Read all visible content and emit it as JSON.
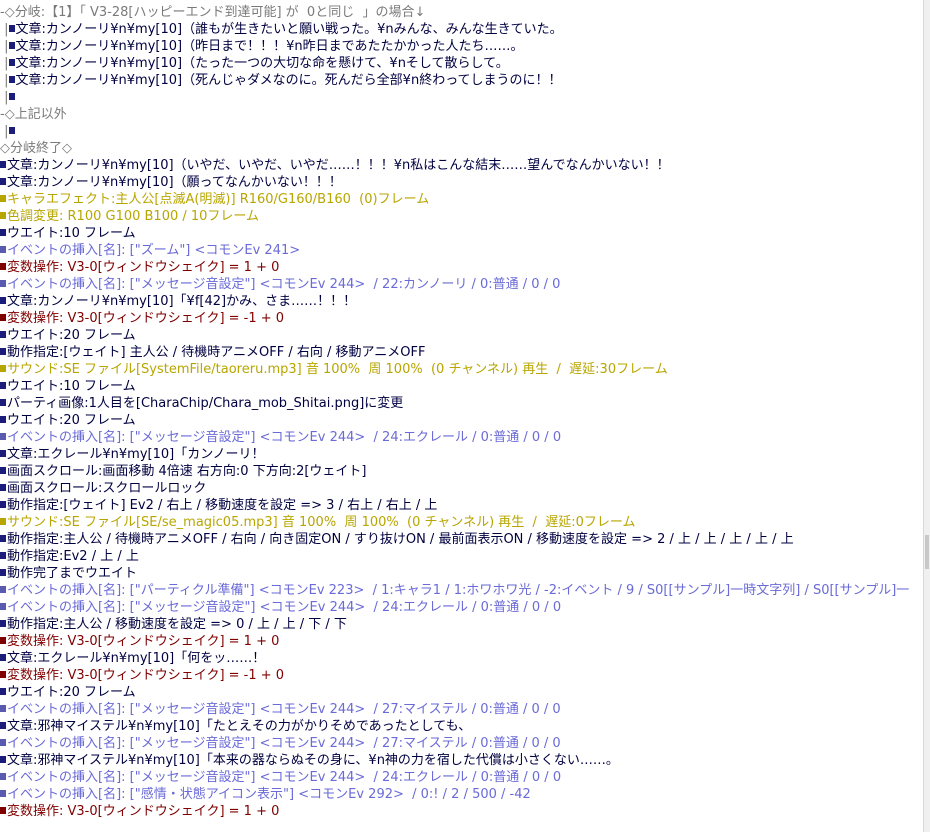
{
  "colors": {
    "message": "#000040",
    "comment": "#7a7a7a",
    "event": "#6a6ad8",
    "variable": "#800000",
    "effect": "#b8a600",
    "square_message": "#1c1c7a",
    "square_event": "#5a5ab0",
    "square_var": "#800000",
    "square_yellow": "#b8a600"
  },
  "lines": [
    {
      "indent": "-",
      "color": "comment",
      "square": null,
      "text": "◇分岐:【1】「 V3-28[ハッピーエンド到達可能] が  0と同じ  」の場合↓"
    },
    {
      "indent": " |",
      "color": "message",
      "square": "message",
      "text": "文章:カンノーリ¥n¥my[10]（誰もが生きたいと願い戦った。¥nみんな、みんな生きていた。"
    },
    {
      "indent": " |",
      "color": "message",
      "square": "message",
      "text": "文章:カンノーリ¥n¥my[10]（昨日まで！！！¥n昨日まであたたかかった人たち……。"
    },
    {
      "indent": " |",
      "color": "message",
      "square": "message",
      "text": "文章:カンノーリ¥n¥my[10]（たった一つの大切な命を懸けて、¥nそして散らして。"
    },
    {
      "indent": " |",
      "color": "message",
      "square": "message",
      "text": "文章:カンノーリ¥n¥my[10]（死んじゃダメなのに。死んだら全部¥n終わってしまうのに！！"
    },
    {
      "indent": " |",
      "color": "message",
      "square": "message",
      "text": ""
    },
    {
      "indent": "-",
      "color": "comment",
      "square": null,
      "text": "◇上記以外"
    },
    {
      "indent": " |",
      "color": "message",
      "square": "message",
      "text": ""
    },
    {
      "indent": "",
      "color": "comment",
      "square": null,
      "text": "◇分岐終了◇"
    },
    {
      "indent": "",
      "color": "message",
      "square": "message",
      "text": "文章:カンノーリ¥n¥my[10]（いやだ、いやだ、いやだ……！！！¥n私はこんな結末……望んでなんかいない！！"
    },
    {
      "indent": "",
      "color": "message",
      "square": "message",
      "text": "文章:カンノーリ¥n¥my[10]（願ってなんかいない！！！"
    },
    {
      "indent": "",
      "color": "effect",
      "square": "yellow",
      "text": "キャラエフェクト:主人公[点滅A(明滅)] R160/G160/B160  (0)フレーム"
    },
    {
      "indent": "",
      "color": "effect",
      "square": "yellow",
      "text": "色調変更: R100 G100 B100 / 10フレーム"
    },
    {
      "indent": "",
      "color": "message",
      "square": "message",
      "text": "ウエイト:10 フレーム"
    },
    {
      "indent": "",
      "color": "event",
      "square": "event",
      "text": "イベントの挿入[名]: [\"ズーム\"] <コモンEv 241>"
    },
    {
      "indent": "",
      "color": "variable",
      "square": "var",
      "text": "変数操作: V3-0[ウィンドウシェイク] = 1 + 0"
    },
    {
      "indent": "",
      "color": "event",
      "square": "event",
      "text": "イベントの挿入[名]: [\"メッセージ音設定\"] <コモンEv 244>  / 22:カンノーリ / 0:普通 / 0 / 0"
    },
    {
      "indent": "",
      "color": "message",
      "square": "message",
      "text": "文章:カンノーリ¥n¥my[10]「¥f[42]かみ、さま……！！！"
    },
    {
      "indent": "",
      "color": "variable",
      "square": "var",
      "text": "変数操作: V3-0[ウィンドウシェイク] = -1 + 0"
    },
    {
      "indent": "",
      "color": "message",
      "square": "message",
      "text": "ウエイト:20 フレーム"
    },
    {
      "indent": "",
      "color": "message",
      "square": "message",
      "text": "動作指定:[ウェイト] 主人公 / 待機時アニメOFF / 右向 / 移動アニメOFF"
    },
    {
      "indent": "",
      "color": "effect",
      "square": "yellow",
      "text": "サウンド:SE ファイル[SystemFile/taoreru.mp3] 音 100%  周 100%  (0 チャンネル) 再生  /  遅延:30フレーム"
    },
    {
      "indent": "",
      "color": "message",
      "square": "message",
      "text": "ウエイト:10 フレーム"
    },
    {
      "indent": "",
      "color": "message",
      "square": "message",
      "text": "パーティ画像:1人目を[CharaChip/Chara_mob_Shitai.png]に変更"
    },
    {
      "indent": "",
      "color": "message",
      "square": "message",
      "text": "ウエイト:20 フレーム"
    },
    {
      "indent": "",
      "color": "event",
      "square": "event",
      "text": "イベントの挿入[名]: [\"メッセージ音設定\"] <コモンEv 244>  / 24:エクレール / 0:普通 / 0 / 0"
    },
    {
      "indent": "",
      "color": "message",
      "square": "message",
      "text": "文章:エクレール¥n¥my[10]「カンノーリ！"
    },
    {
      "indent": "",
      "color": "message",
      "square": "message",
      "text": "画面スクロール:画面移動 4倍速 右方向:0 下方向:2[ウェイト]"
    },
    {
      "indent": "",
      "color": "message",
      "square": "message",
      "text": "画面スクロール:スクロールロック"
    },
    {
      "indent": "",
      "color": "message",
      "square": "message",
      "text": "動作指定:[ウェイト] Ev2 / 右上 / 移動速度を設定 => 3 / 右上 / 右上 / 上"
    },
    {
      "indent": "",
      "color": "effect",
      "square": "yellow",
      "text": "サウンド:SE ファイル[SE/se_magic05.mp3] 音 100%  周 100%  (0 チャンネル) 再生  /  遅延:0フレーム"
    },
    {
      "indent": "",
      "color": "message",
      "square": "message",
      "text": "動作指定:主人公 / 待機時アニメOFF / 右向 / 向き固定ON / すり抜けON / 最前面表示ON / 移動速度を設定 => 2 / 上 / 上 / 上 / 上 / 上"
    },
    {
      "indent": "",
      "color": "message",
      "square": "message",
      "text": "動作指定:Ev2 / 上 / 上"
    },
    {
      "indent": "",
      "color": "message",
      "square": "message",
      "text": "動作完了までウエイト"
    },
    {
      "indent": "",
      "color": "event",
      "square": "event",
      "text": "イベントの挿入[名]: [\"パーティクル準備\"] <コモンEv 223>  / 1:キャラ1 / 1:ホワホワ光 / -2:イベント / 9 / S0[[サンプル]一時文字列] / S0[[サンプル]一"
    },
    {
      "indent": "",
      "color": "event",
      "square": "event",
      "text": "イベントの挿入[名]: [\"メッセージ音設定\"] <コモンEv 244>  / 24:エクレール / 0:普通 / 0 / 0"
    },
    {
      "indent": "",
      "color": "message",
      "square": "message",
      "text": "動作指定:主人公 / 移動速度を設定 => 0 / 上 / 上 / 下 / 下"
    },
    {
      "indent": "",
      "color": "variable",
      "square": "var",
      "text": "変数操作: V3-0[ウィンドウシェイク] = 1 + 0"
    },
    {
      "indent": "",
      "color": "message",
      "square": "message",
      "text": "文章:エクレール¥n¥my[10]「何をッ……！"
    },
    {
      "indent": "",
      "color": "variable",
      "square": "var",
      "text": "変数操作: V3-0[ウィンドウシェイク] = -1 + 0"
    },
    {
      "indent": "",
      "color": "message",
      "square": "message",
      "text": "ウエイト:20 フレーム"
    },
    {
      "indent": "",
      "color": "event",
      "square": "event",
      "text": "イベントの挿入[名]: [\"メッセージ音設定\"] <コモンEv 244>  / 27:マイステル / 0:普通 / 0 / 0"
    },
    {
      "indent": "",
      "color": "message",
      "square": "message",
      "text": "文章:邪神マイステル¥n¥my[10]「たとえその力がかりそめであったとしても、"
    },
    {
      "indent": "",
      "color": "event",
      "square": "event",
      "text": "イベントの挿入[名]: [\"メッセージ音設定\"] <コモンEv 244>  / 27:マイステル / 0:普通 / 0 / 0"
    },
    {
      "indent": "",
      "color": "message",
      "square": "message",
      "text": "文章:邪神マイステル¥n¥my[10]「本来の器ならぬその身に、¥n神の力を宿した代償は小さくない……。"
    },
    {
      "indent": "",
      "color": "event",
      "square": "event",
      "text": "イベントの挿入[名]: [\"メッセージ音設定\"] <コモンEv 244>  / 24:エクレール / 0:普通 / 0 / 0"
    },
    {
      "indent": "",
      "color": "event",
      "square": "event",
      "text": "イベントの挿入[名]: [\"感情・状態アイコン表示\"] <コモンEv 292>  / 0:! / 2 / 500 / -42"
    },
    {
      "indent": "",
      "color": "variable",
      "square": "var",
      "text": "変数操作: V3-0[ウィンドウシェイク] = 1 + 0"
    }
  ]
}
